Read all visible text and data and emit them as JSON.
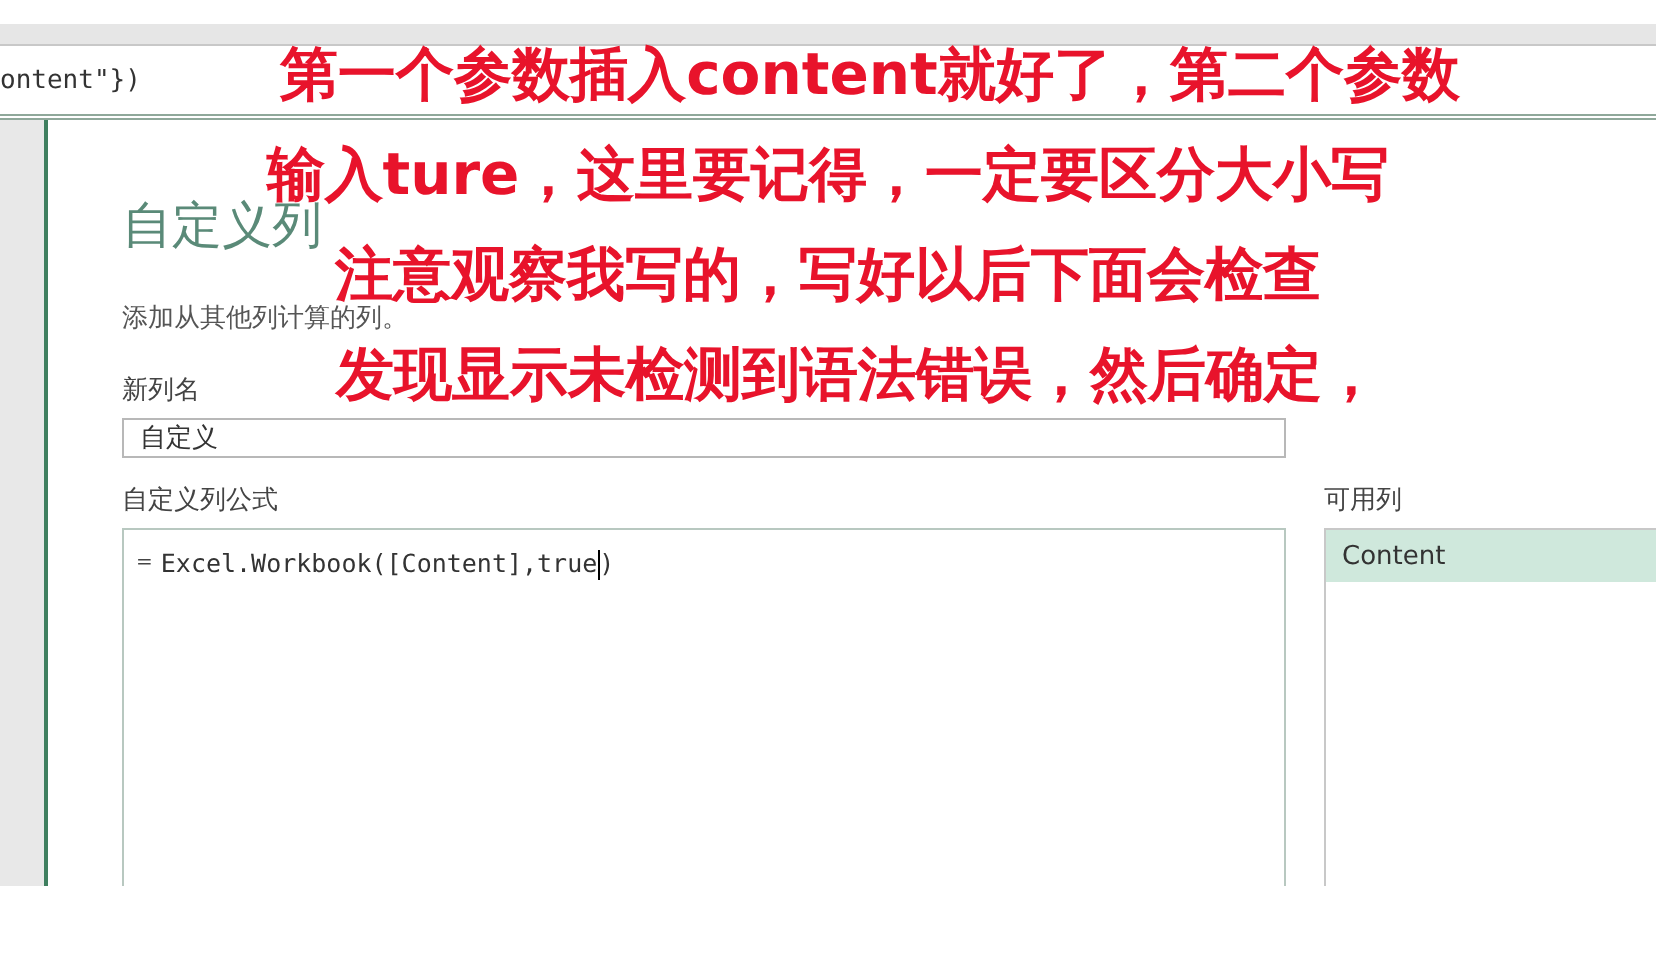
{
  "formula_bar": {
    "text": "ontent\"})"
  },
  "dialog": {
    "title": "自定义列",
    "description": "添加从其他列计算的列。",
    "name_label": "新列名",
    "name_value": "自定义",
    "formula_label": "自定义列公式",
    "formula_prefix": "=",
    "formula_value": "Excel.Workbook([Content],true",
    "formula_tail": ")",
    "columns_label": "可用列",
    "columns": [
      {
        "label": "Content",
        "selected": true
      }
    ]
  },
  "annotations": [
    "第一个参数插入content就好了，第二个参数",
    "输入ture，这里要记得，一定要区分大小写",
    "注意观察我写的，写好以后下面会检查",
    "发现显示未检测到语法错误，然后确定，"
  ]
}
